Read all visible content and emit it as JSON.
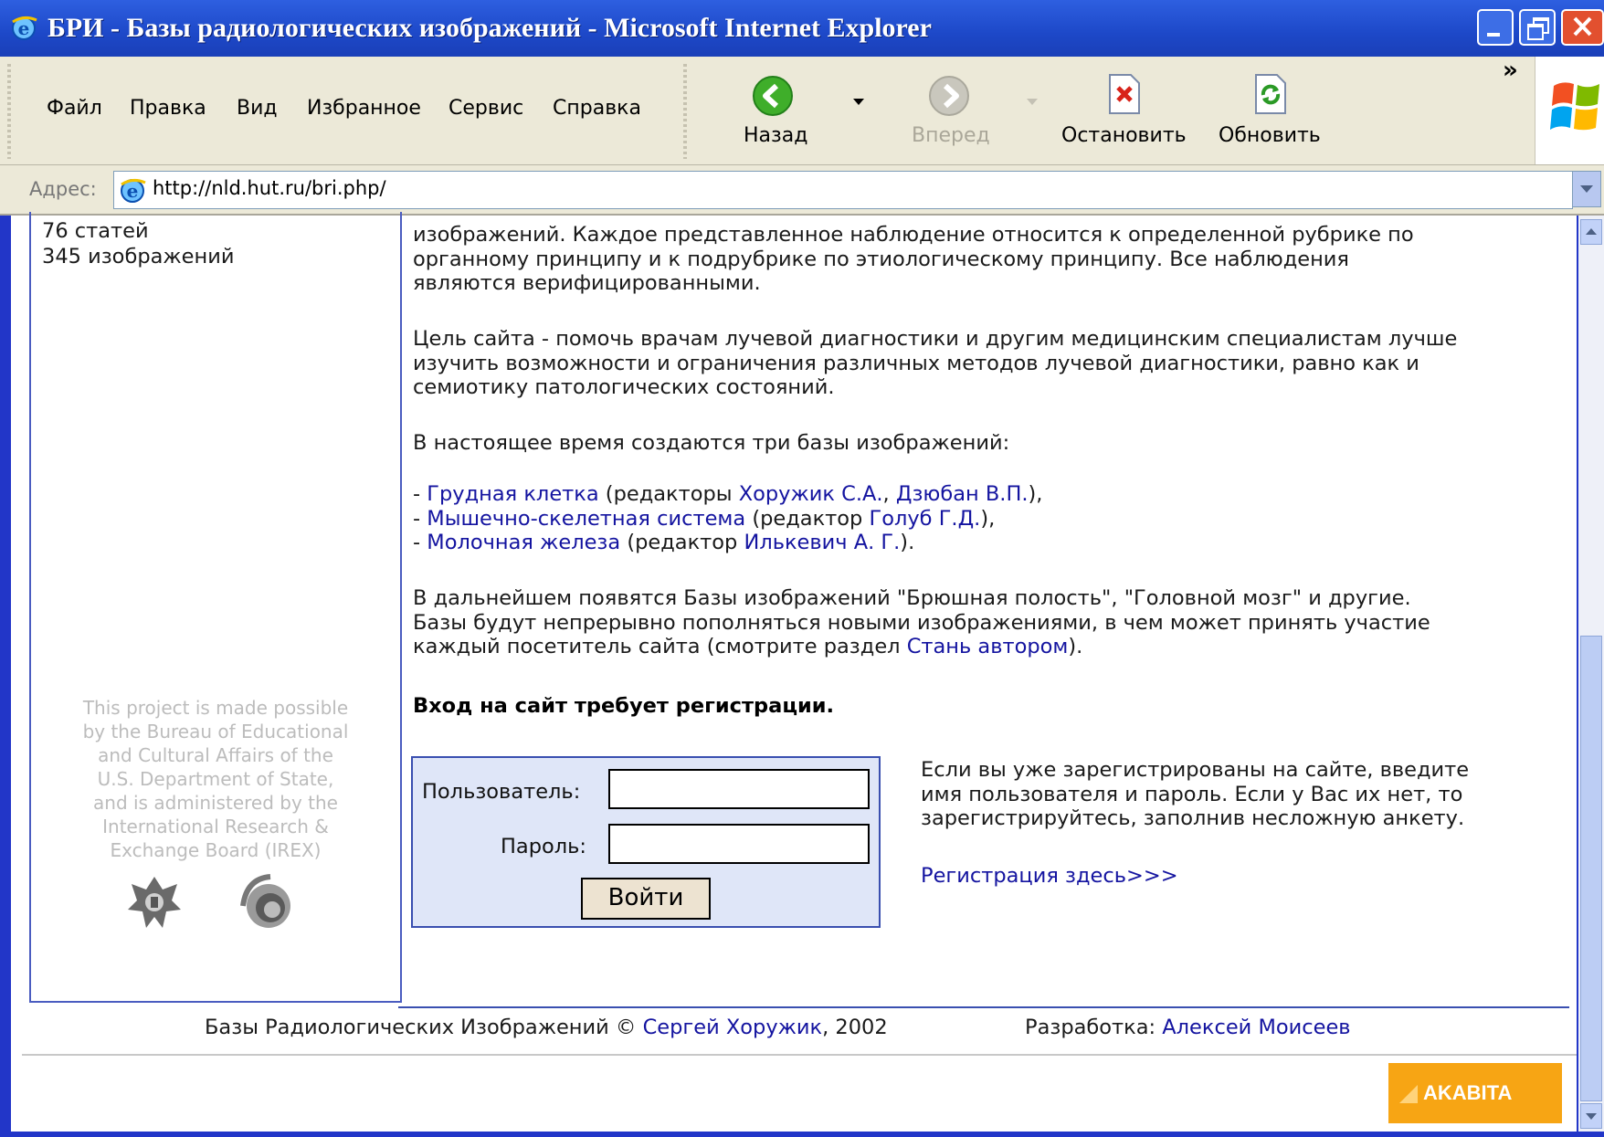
{
  "window": {
    "title": "БРИ - Базы радиологических изображений - Microsoft Internet Explorer"
  },
  "menu": [
    "Файл",
    "Правка",
    "Вид",
    "Избранное",
    "Сервис",
    "Справка"
  ],
  "toolbar": {
    "back_label": "Назад",
    "forward_label": "Вперед",
    "stop_label": "Остановить",
    "refresh_label": "Обновить",
    "more": "»"
  },
  "address": {
    "label": "Адрес:",
    "url": "http://nld.hut.ru/bri.php/"
  },
  "sidebar": {
    "stats": [
      "76 статей",
      "345 изображений"
    ],
    "sponsor_lines": [
      "This project is made possible",
      "by the Bureau of Educational",
      "and Cultural Affairs of the",
      "U.S. Department of State,",
      "and is administered by the",
      "International Research &",
      "Exchange Board (IREX)"
    ]
  },
  "main": {
    "intro": [
      "изображений. Каждое представленное наблюдение относится к определенной рубрике по",
      "органному принципу и к подрубрике по этиологическому принципу. Все наблюдения",
      "являются верифицированными."
    ],
    "goal": [
      "Цель сайта - помочь врачам лучевой диагностики и другим медицинским специалистам лучше",
      "изучить возможности и ограничения различных методов лучевой диагностики, равно как и",
      "семиотику патологических состояний."
    ],
    "currently": "В настоящее время создаются три базы изображений:",
    "databases": [
      {
        "prefix": "- ",
        "name": "Грудная клетка",
        "mid": " (редакторы ",
        "editors": [
          "Хоружик С.А.",
          "Дзюбан В.П."
        ],
        "suffix": "),"
      },
      {
        "prefix": "- ",
        "name": "Мышечно-скелетная система",
        "mid": " (редактор ",
        "editors": [
          "Голуб Г.Д."
        ],
        "suffix": "),"
      },
      {
        "prefix": "- ",
        "name": "Молочная железа",
        "mid": " (редактор ",
        "editors": [
          "Илькевич А. Г."
        ],
        "suffix": ")."
      }
    ],
    "future": [
      "В дальнейшем появятся Базы изображений \"Брюшная полость\", \"Головной мозг\" и другие.",
      "Базы будут непрерывно пополняться новыми изображениями, в чем может принять участие",
      "каждый посетитель сайта (смотрите раздел "
    ],
    "future_link": "Стань автором",
    "future_end": ").",
    "login_required": "Вход на сайт требует регистрации."
  },
  "login": {
    "user_label": "Пользователь:",
    "password_label": "Пароль:",
    "user_value": "",
    "password_value": "",
    "submit_label": "Войти",
    "info": [
      "Если вы уже зарегистрированы на сайте, введите",
      "имя пользователя и пароль. Если у Вас их нет, то",
      "зарегистрируйтесь, заполнив несложную анкету."
    ],
    "register_link": "Регистрация здесь>>>"
  },
  "footer": {
    "copyright_prefix": "Базы Радиологических Изображений © ",
    "author_link": "Сергей Хоружик",
    "year": ", 2002",
    "dev_label": "Разработка: ",
    "dev_link": "Алексей Моисеев",
    "badge_label": "AKABITA"
  },
  "colors": {
    "link": "#1414a0",
    "login_box_bg": "#dfe6f8",
    "border_blue": "#3a4fb0",
    "badge_orange": "#f7a514"
  }
}
